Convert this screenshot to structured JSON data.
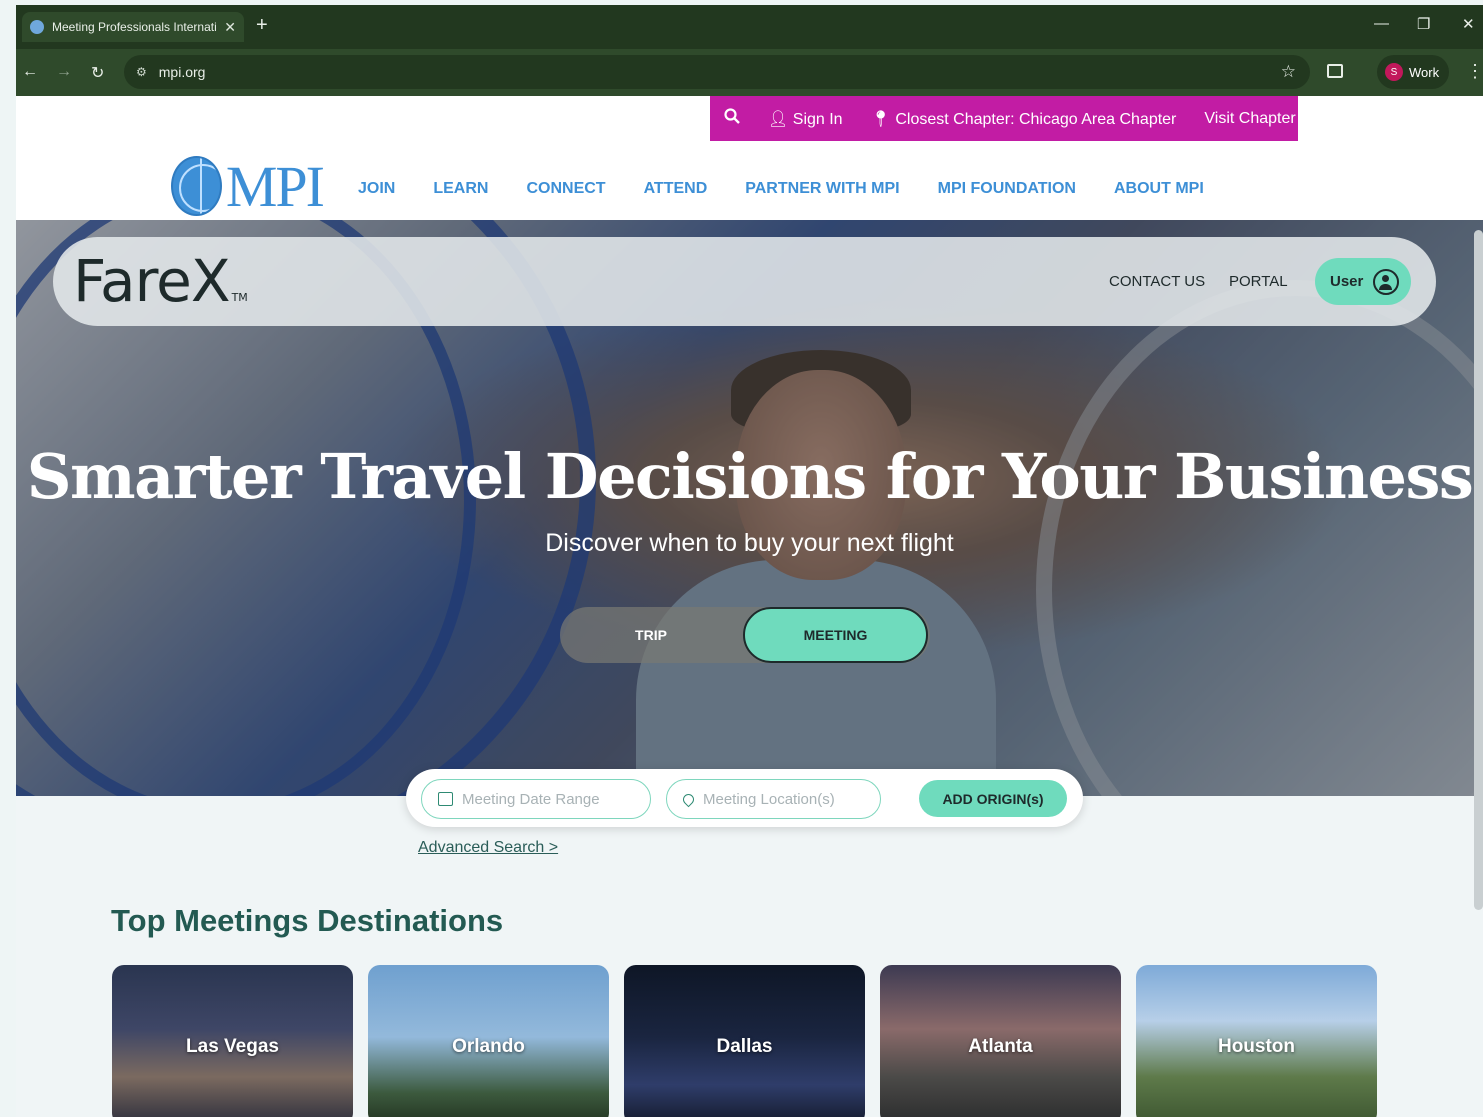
{
  "browser": {
    "tab_title": "Meeting Professionals Internati",
    "tab_close": "✕",
    "new_tab": "+",
    "url": "mpi.org",
    "profile_initial": "S",
    "profile_label": "Work",
    "window_controls": [
      "—",
      "❐",
      "✕"
    ]
  },
  "mpi": {
    "utility": {
      "search_icon": "search-icon",
      "sign_in": "Sign In",
      "closest_chapter": "Closest Chapter: Chicago Area Chapter",
      "visit_chapter": "Visit Chapter"
    },
    "logo_text": "MPI",
    "nav": [
      "JOIN",
      "LEARN",
      "CONNECT",
      "ATTEND",
      "PARTNER WITH MPI",
      "MPI FOUNDATION",
      "ABOUT MPI"
    ]
  },
  "farex": {
    "logo": "FareX",
    "tm": "TM",
    "contact_us": "CONTACT US",
    "portal": "PORTAL",
    "user": "User"
  },
  "hero": {
    "title": "Smarter Travel Decisions for Your Business",
    "subtitle": "Discover when to buy your next flight",
    "toggle": {
      "trip": "TRIP",
      "meeting": "MEETING",
      "selected": "MEETING"
    }
  },
  "search": {
    "date_placeholder": "Meeting Date Range",
    "location_placeholder": "Meeting Location(s)",
    "add_origin": "ADD ORIGIN(s)",
    "advanced": "Advanced Search >"
  },
  "destinations": {
    "title": "Top Meetings Destinations",
    "items": [
      {
        "name": "Las Vegas"
      },
      {
        "name": "Orlando"
      },
      {
        "name": "Dallas"
      },
      {
        "name": "Atlanta"
      },
      {
        "name": "Houston"
      }
    ]
  },
  "colors": {
    "chrome_dark": "#22381f",
    "chrome_mid": "#2f4a2b",
    "mpi_magenta": "#c21ca4",
    "mpi_blue": "#3d8fd6",
    "farex_mint": "#6fdbbd",
    "heading_green": "#235a52"
  }
}
